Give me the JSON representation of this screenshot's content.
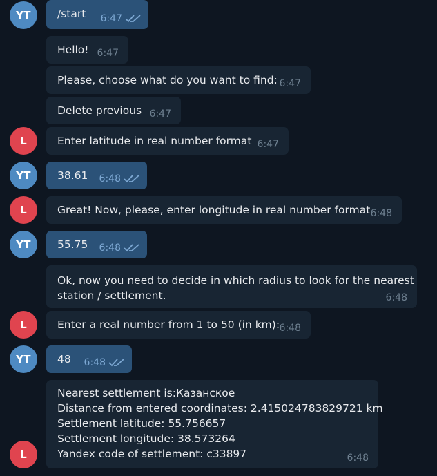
{
  "avatars": {
    "user": {
      "initials": "YT",
      "color": "#4e8ac2"
    },
    "bot": {
      "initials": "L",
      "color": "#e0444f"
    }
  },
  "messages": [
    {
      "text": "/start",
      "time": "6:47"
    },
    {
      "text": "Hello!",
      "time": "6:47"
    },
    {
      "text": "Please, choose what do you want to find:",
      "time": "6:47"
    },
    {
      "text": "Delete previous",
      "time": "6:47"
    },
    {
      "text": "Enter latitude in real number format",
      "time": "6:47"
    },
    {
      "text": "38.61",
      "time": "6:48"
    },
    {
      "text": "Great! Now, please, enter longitude in real number format",
      "time": "6:48"
    },
    {
      "text": "55.75",
      "time": "6:48"
    },
    {
      "lines": [
        "Ok, now you need to decide in which radius to look for the nearest",
        "station / settlement."
      ],
      "time": "6:48"
    },
    {
      "text": "Enter a real number from 1 to 50 (in km):",
      "time": "6:48"
    },
    {
      "text": "48",
      "time": "6:48"
    },
    {
      "lines": [
        "Nearest settlement is:Казанское",
        "Distance from entered coordinates: 2.415024783829721 km",
        "Settlement latitude: 55.756657",
        "Settlement longitude: 38.573264",
        "Yandex code of settlement: c33897"
      ],
      "time": "6:48"
    }
  ]
}
